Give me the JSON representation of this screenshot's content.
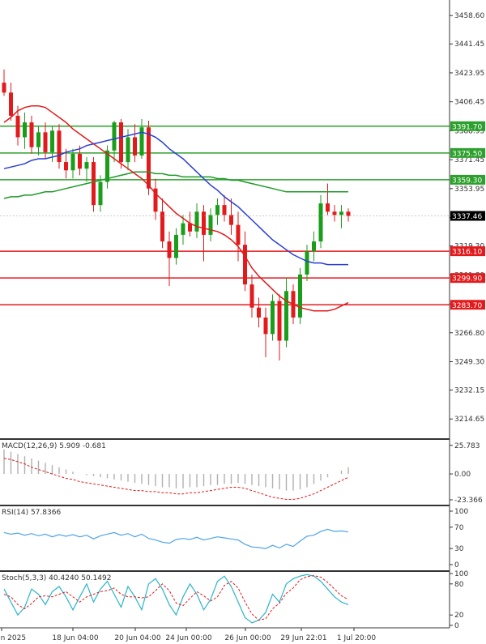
{
  "chart_data": {
    "type": "candlestick",
    "main": {
      "y_ticks": [
        "3458.60",
        "3441.45",
        "3423.95",
        "3406.45",
        "3388.95",
        "3371.45",
        "3353.95",
        "3336.45",
        "3319.30",
        "3301.80",
        "3284.30",
        "3266.80",
        "3249.30",
        "3232.15",
        "3214.65"
      ],
      "y_range": [
        3203,
        3468
      ],
      "last_price": "3337.46",
      "candles": [
        {
          "o": 3418,
          "h": 3426,
          "l": 3410,
          "c": 3412
        },
        {
          "o": 3412,
          "h": 3418,
          "l": 3395,
          "c": 3398
        },
        {
          "o": 3398,
          "h": 3404,
          "l": 3380,
          "c": 3385
        },
        {
          "o": 3385,
          "h": 3400,
          "l": 3378,
          "c": 3394
        },
        {
          "o": 3394,
          "h": 3398,
          "l": 3375,
          "c": 3379
        },
        {
          "o": 3379,
          "h": 3392,
          "l": 3374,
          "c": 3388
        },
        {
          "o": 3388,
          "h": 3394,
          "l": 3372,
          "c": 3376
        },
        {
          "o": 3376,
          "h": 3392,
          "l": 3370,
          "c": 3389
        },
        {
          "o": 3389,
          "h": 3393,
          "l": 3366,
          "c": 3370
        },
        {
          "o": 3370,
          "h": 3378,
          "l": 3360,
          "c": 3365
        },
        {
          "o": 3365,
          "h": 3378,
          "l": 3360,
          "c": 3375
        },
        {
          "o": 3375,
          "h": 3380,
          "l": 3362,
          "c": 3366
        },
        {
          "o": 3366,
          "h": 3373,
          "l": 3358,
          "c": 3370
        },
        {
          "o": 3370,
          "h": 3373,
          "l": 3340,
          "c": 3344
        },
        {
          "o": 3344,
          "h": 3362,
          "l": 3340,
          "c": 3358
        },
        {
          "o": 3358,
          "h": 3380,
          "l": 3354,
          "c": 3377
        },
        {
          "o": 3377,
          "h": 3395,
          "l": 3370,
          "c": 3394
        },
        {
          "o": 3394,
          "h": 3396,
          "l": 3366,
          "c": 3370
        },
        {
          "o": 3370,
          "h": 3390,
          "l": 3365,
          "c": 3385
        },
        {
          "o": 3385,
          "h": 3393,
          "l": 3370,
          "c": 3374
        },
        {
          "o": 3374,
          "h": 3396,
          "l": 3372,
          "c": 3391
        },
        {
          "o": 3391,
          "h": 3395,
          "l": 3350,
          "c": 3354
        },
        {
          "o": 3354,
          "h": 3360,
          "l": 3335,
          "c": 3340
        },
        {
          "o": 3340,
          "h": 3348,
          "l": 3318,
          "c": 3322
        },
        {
          "o": 3322,
          "h": 3328,
          "l": 3295,
          "c": 3312
        },
        {
          "o": 3312,
          "h": 3330,
          "l": 3308,
          "c": 3326
        },
        {
          "o": 3326,
          "h": 3338,
          "l": 3320,
          "c": 3333
        },
        {
          "o": 3333,
          "h": 3340,
          "l": 3325,
          "c": 3328
        },
        {
          "o": 3328,
          "h": 3345,
          "l": 3324,
          "c": 3340
        },
        {
          "o": 3340,
          "h": 3344,
          "l": 3310,
          "c": 3326
        },
        {
          "o": 3326,
          "h": 3342,
          "l": 3322,
          "c": 3338
        },
        {
          "o": 3338,
          "h": 3348,
          "l": 3332,
          "c": 3344
        },
        {
          "o": 3344,
          "h": 3350,
          "l": 3334,
          "c": 3338
        },
        {
          "o": 3338,
          "h": 3348,
          "l": 3326,
          "c": 3332
        },
        {
          "o": 3332,
          "h": 3340,
          "l": 3310,
          "c": 3320
        },
        {
          "o": 3320,
          "h": 3328,
          "l": 3292,
          "c": 3296
        },
        {
          "o": 3296,
          "h": 3302,
          "l": 3276,
          "c": 3282
        },
        {
          "o": 3282,
          "h": 3288,
          "l": 3270,
          "c": 3276
        },
        {
          "o": 3276,
          "h": 3282,
          "l": 3252,
          "c": 3266
        },
        {
          "o": 3266,
          "h": 3290,
          "l": 3262,
          "c": 3286
        },
        {
          "o": 3286,
          "h": 3290,
          "l": 3250,
          "c": 3262
        },
        {
          "o": 3262,
          "h": 3300,
          "l": 3258,
          "c": 3292
        },
        {
          "o": 3292,
          "h": 3296,
          "l": 3272,
          "c": 3276
        },
        {
          "o": 3276,
          "h": 3306,
          "l": 3272,
          "c": 3302
        },
        {
          "o": 3302,
          "h": 3320,
          "l": 3298,
          "c": 3316
        },
        {
          "o": 3316,
          "h": 3328,
          "l": 3310,
          "c": 3322
        },
        {
          "o": 3322,
          "h": 3350,
          "l": 3318,
          "c": 3345
        },
        {
          "o": 3345,
          "h": 3357,
          "l": 3338,
          "c": 3340
        },
        {
          "o": 3340,
          "h": 3344,
          "l": 3334,
          "c": 3338
        },
        {
          "o": 3338,
          "h": 3344,
          "l": 3330,
          "c": 3340
        },
        {
          "o": 3340,
          "h": 3342,
          "l": 3334,
          "c": 3337.46
        }
      ],
      "blue_line": [
        3366,
        3367,
        3368,
        3369,
        3371,
        3372,
        3372,
        3373,
        3374,
        3376,
        3377,
        3378,
        3380,
        3381,
        3382,
        3383,
        3384,
        3385,
        3386,
        3387,
        3388,
        3387,
        3385,
        3382,
        3378,
        3375,
        3372,
        3368,
        3364,
        3360,
        3356,
        3353,
        3349,
        3346,
        3343,
        3339,
        3335,
        3331,
        3327,
        3323,
        3320,
        3317,
        3314,
        3312,
        3310,
        3309,
        3309,
        3308,
        3308,
        3308,
        3308
      ],
      "red_line": [
        3394,
        3397,
        3401,
        3403,
        3404,
        3404,
        3403,
        3400,
        3397,
        3394,
        3390,
        3387,
        3384,
        3381,
        3378,
        3375,
        3372,
        3369,
        3366,
        3363,
        3360,
        3356,
        3351,
        3347,
        3343,
        3339,
        3336,
        3333,
        3331,
        3330,
        3329,
        3328,
        3326,
        3323,
        3319,
        3313,
        3306,
        3301,
        3297,
        3293,
        3289,
        3286,
        3284,
        3282,
        3281,
        3280,
        3280,
        3280,
        3281,
        3283,
        3285
      ],
      "green_line": [
        3348,
        3349,
        3349,
        3350,
        3350,
        3351,
        3352,
        3352,
        3353,
        3354,
        3355,
        3356,
        3357,
        3358,
        3359,
        3360,
        3361,
        3362,
        3363,
        3364,
        3364,
        3364,
        3363,
        3363,
        3362,
        3362,
        3361,
        3361,
        3361,
        3361,
        3361,
        3360,
        3360,
        3359,
        3359,
        3358,
        3357,
        3356,
        3355,
        3354,
        3353,
        3352,
        3352,
        3352,
        3352,
        3352,
        3352,
        3352,
        3352,
        3352,
        3352
      ],
      "levels": [
        {
          "label": "3391.70",
          "color": "#2ca02c"
        },
        {
          "label": "3375.50",
          "color": "#2ca02c"
        },
        {
          "label": "3359.30",
          "color": "#2ca02c"
        },
        {
          "label": "3316.10",
          "color": "#e31a1c"
        },
        {
          "label": "3299.90",
          "color": "#e31a1c"
        },
        {
          "label": "3283.70",
          "color": "#e31a1c"
        }
      ]
    },
    "macd": {
      "title": "MACD(12,26,9) 5.909 -0.681",
      "y_ticks": [
        "25.783",
        "0.00",
        "-23.366"
      ],
      "y_range": [
        -27,
        30
      ],
      "hist": [
        22,
        20,
        18,
        16,
        14,
        12,
        10,
        8,
        6,
        4,
        2,
        0,
        -1,
        -2,
        -3,
        -4,
        -5,
        -6,
        -7,
        -8,
        -9,
        -10,
        -11,
        -12,
        -12,
        -13,
        -13,
        -12,
        -12,
        -11,
        -10,
        -10,
        -9,
        -9,
        -8,
        -9,
        -10,
        -11,
        -12,
        -13,
        -14,
        -15,
        -15,
        -14,
        -12,
        -9,
        -6,
        -3,
        0,
        3,
        6
      ],
      "signal": [
        14,
        13,
        11,
        9,
        6,
        4,
        2,
        0,
        -2,
        -4,
        -5,
        -7,
        -8,
        -9,
        -10,
        -11,
        -12,
        -13,
        -14,
        -15,
        -15,
        -16,
        -16,
        -17,
        -17,
        -18,
        -18,
        -17,
        -17,
        -16,
        -15,
        -14,
        -13,
        -12,
        -12,
        -13,
        -15,
        -17,
        -19,
        -21,
        -22,
        -23,
        -23,
        -22,
        -20,
        -18,
        -15,
        -12,
        -9,
        -6,
        -3
      ]
    },
    "rsi": {
      "title": "RSI(14) 57.8366",
      "y_ticks": [
        "100",
        "70",
        "30",
        "0"
      ],
      "y_range": [
        0,
        100
      ],
      "values": [
        60,
        57,
        59,
        55,
        58,
        54,
        57,
        52,
        56,
        53,
        56,
        52,
        55,
        48,
        54,
        57,
        60,
        55,
        58,
        52,
        57,
        49,
        46,
        42,
        40,
        47,
        49,
        47,
        51,
        46,
        49,
        52,
        50,
        48,
        46,
        38,
        33,
        32,
        30,
        36,
        31,
        38,
        34,
        44,
        53,
        55,
        62,
        66,
        62,
        63,
        61
      ]
    },
    "stoch": {
      "title": "Stoch(5,3,3) 40.4240 50.1492",
      "y_ticks": [
        "100",
        "80",
        "20",
        "0"
      ],
      "y_range": [
        0,
        100
      ],
      "k": [
        70,
        45,
        20,
        35,
        70,
        60,
        40,
        65,
        75,
        55,
        30,
        55,
        80,
        45,
        70,
        85,
        60,
        35,
        75,
        55,
        30,
        80,
        90,
        70,
        40,
        20,
        55,
        80,
        60,
        30,
        50,
        85,
        95,
        75,
        45,
        15,
        5,
        10,
        25,
        60,
        45,
        80,
        90,
        95,
        98,
        95,
        85,
        70,
        55,
        45,
        40
      ],
      "d": [
        60,
        55,
        40,
        32,
        42,
        55,
        57,
        55,
        60,
        65,
        55,
        45,
        55,
        60,
        65,
        67,
        72,
        60,
        55,
        55,
        53,
        55,
        67,
        80,
        67,
        43,
        38,
        52,
        65,
        57,
        47,
        55,
        77,
        85,
        72,
        45,
        22,
        10,
        13,
        32,
        43,
        62,
        72,
        88,
        94,
        96,
        93,
        83,
        70,
        57,
        50
      ]
    },
    "x_labels": [
      "16 Jun 2025",
      "18 Jun 04:00",
      "20 Jun 04:00",
      "24 Jun 00:00",
      "26 Jun 00:00",
      "29 Jun 22:01",
      "1 Jul 20:00"
    ],
    "colors": {
      "bull": "#1a9e1a",
      "bear": "#e31a1c",
      "blue": "#2a3fd4",
      "red": "#e31a1c",
      "green": "#1f9a2a",
      "grid": "#333333"
    }
  }
}
